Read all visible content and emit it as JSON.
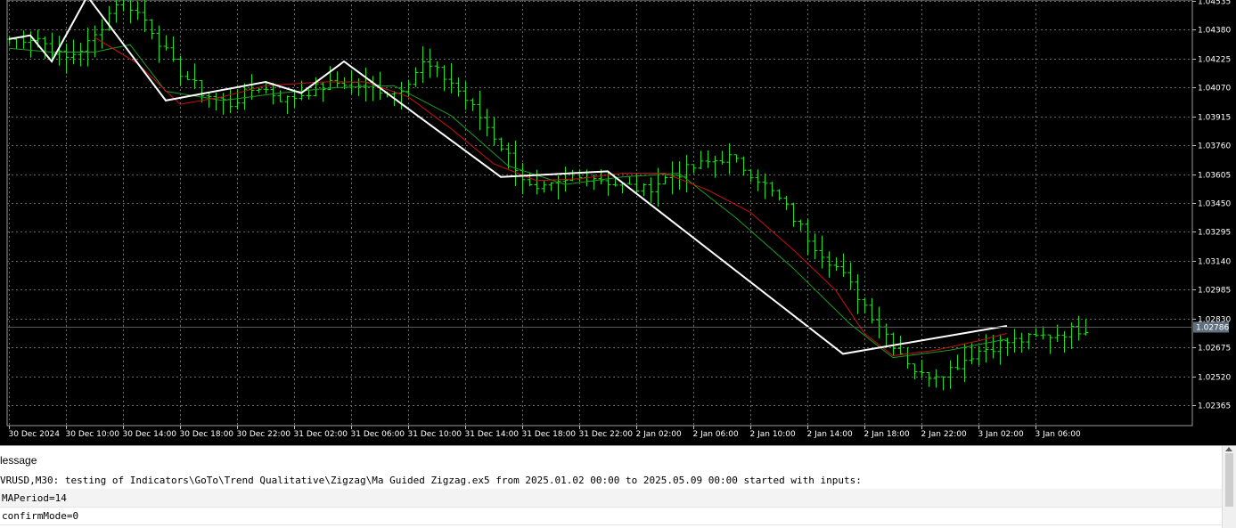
{
  "chart_data": {
    "type": "candlestick",
    "symbol": "EURUSD",
    "timeframe": "M30",
    "grid": true,
    "colors": {
      "background": "#000000",
      "grid": "#6a6a6a",
      "bars": "#22dd22",
      "zigzag": "#ffffff",
      "ma_fast": "#cc1111",
      "ma_slow": "#1e9e1e",
      "axis_text": "#ffffff",
      "bid_line": "#5a5a5a",
      "price_tag_bg": "#607080"
    },
    "ylim": [
      1.0225,
      1.04535
    ],
    "y_ticks": [
      "1.04535",
      "1.04380",
      "1.04225",
      "1.04070",
      "1.03915",
      "1.03760",
      "1.03605",
      "1.03450",
      "1.03295",
      "1.03140",
      "1.02985",
      "1.02830",
      "1.02675",
      "1.02520",
      "1.02365"
    ],
    "x_ticks": [
      "30 Dec 2024",
      "30 Dec 10:00",
      "30 Dec 14:00",
      "30 Dec 18:00",
      "30 Dec 22:00",
      "31 Dec 02:00",
      "31 Dec 06:00",
      "31 Dec 10:00",
      "31 Dec 14:00",
      "31 Dec 18:00",
      "31 Dec 22:00",
      "2 Jan 02:00",
      "2 Jan 06:00",
      "2 Jan 10:00",
      "2 Jan 14:00",
      "2 Jan 18:00",
      "2 Jan 22:00",
      "3 Jan 02:00",
      "3 Jan 06:00"
    ],
    "current_price": "1.02786",
    "price_anchors": [
      1.0433,
      1.0434,
      1.0422,
      1.0432,
      1.0456,
      1.0442,
      1.0418,
      1.0404,
      1.0398,
      1.0408,
      1.04,
      1.0406,
      1.041,
      1.0408,
      1.0404,
      1.042,
      1.041,
      1.0392,
      1.0372,
      1.035,
      1.0355,
      1.036,
      1.0355,
      1.0352,
      1.036,
      1.0365,
      1.037,
      1.036,
      1.0345,
      1.0325,
      1.031,
      1.029,
      1.027,
      1.0252,
      1.0255,
      1.0265,
      1.027,
      1.0272,
      1.0275,
      1.0278
    ],
    "zigzag": [
      [
        0,
        1.0433
      ],
      [
        3,
        1.0435
      ],
      [
        6,
        1.0421
      ],
      [
        11,
        1.0456
      ],
      [
        22,
        1.04
      ],
      [
        36,
        1.041
      ],
      [
        41,
        1.0404
      ],
      [
        47,
        1.0421
      ],
      [
        69,
        1.0359
      ],
      [
        84,
        1.0362
      ],
      [
        117,
        1.0264
      ],
      [
        140,
        1.0279
      ]
    ],
    "ma_fast": [
      [
        12,
        1.0434
      ],
      [
        18,
        1.042
      ],
      [
        24,
        1.0398
      ],
      [
        30,
        1.0402
      ],
      [
        36,
        1.0408
      ],
      [
        44,
        1.041
      ],
      [
        50,
        1.041
      ],
      [
        56,
        1.0402
      ],
      [
        62,
        1.0385
      ],
      [
        68,
        1.0366
      ],
      [
        74,
        1.0357
      ],
      [
        80,
        1.0358
      ],
      [
        86,
        1.0361
      ],
      [
        92,
        1.0361
      ],
      [
        98,
        1.0352
      ],
      [
        104,
        1.034
      ],
      [
        110,
        1.032
      ],
      [
        116,
        1.0298
      ],
      [
        120,
        1.0275
      ],
      [
        124,
        1.0263
      ],
      [
        130,
        1.0266
      ],
      [
        136,
        1.0271
      ],
      [
        140,
        1.0275
      ]
    ],
    "ma_slow": [
      [
        0,
        1.0428
      ],
      [
        6,
        1.0426
      ],
      [
        12,
        1.0426
      ],
      [
        17,
        1.043
      ],
      [
        22,
        1.0405
      ],
      [
        30,
        1.04
      ],
      [
        38,
        1.0404
      ],
      [
        46,
        1.0407
      ],
      [
        54,
        1.0408
      ],
      [
        62,
        1.0392
      ],
      [
        70,
        1.0365
      ],
      [
        78,
        1.0355
      ],
      [
        86,
        1.0359
      ],
      [
        94,
        1.0361
      ],
      [
        102,
        1.0337
      ],
      [
        110,
        1.031
      ],
      [
        118,
        1.028
      ],
      [
        124,
        1.0262
      ],
      [
        132,
        1.0266
      ],
      [
        140,
        1.0272
      ]
    ]
  },
  "log": {
    "header": "lessage",
    "rows": [
      "VRUSD,M30: testing of Indicators\\GoTo\\Trend Qualitative\\Zigzag\\Ma Guided Zigzag.ex5 from 2025.01.02 00:00 to 2025.05.09 00:00 started with inputs:",
      "MAPeriod=14",
      "confirmMode=0"
    ]
  }
}
